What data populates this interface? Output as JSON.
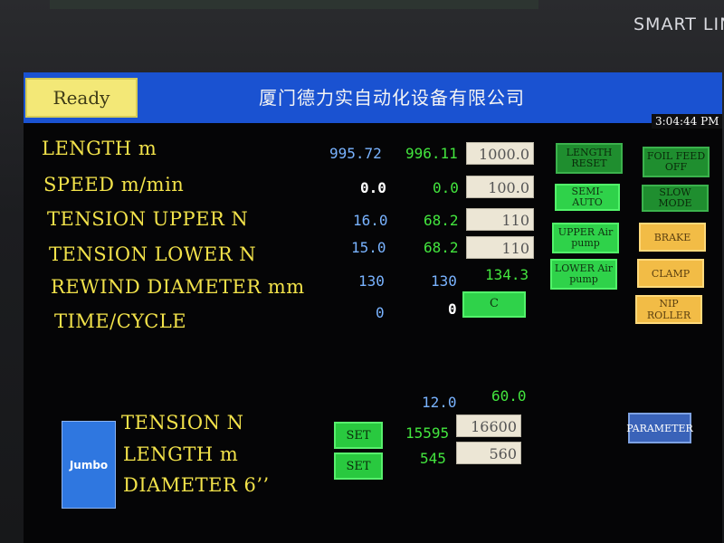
{
  "bezel": {
    "brand": "SMART LIN"
  },
  "header": {
    "status": "Ready",
    "company": "厦门德力实自动化设备有限公司",
    "clock": "3:04:44 PM"
  },
  "rows": [
    {
      "label": "LENGTH m",
      "actual": "995.72",
      "actual2": "996.11",
      "set": "1000.0"
    },
    {
      "label": "SPEED m/min",
      "actual": "0.0",
      "actual2": "0.0",
      "set": "100.0"
    },
    {
      "label": "TENSION UPPER N",
      "actual": "16.0",
      "actual2": "68.2",
      "set": "110"
    },
    {
      "label": "TENSION LOWER N",
      "actual": "15.0",
      "actual2": "68.2",
      "set": "110"
    },
    {
      "label": "REWIND DIAMETER mm",
      "actual": "130",
      "actual2": "130",
      "set": "134.3"
    },
    {
      "label": "TIME/CYCLE",
      "actual": "0",
      "actual2": "0",
      "set": "C"
    }
  ],
  "buttons": {
    "length_reset": "LENGTH RESET",
    "foil_feed_off": "FOIL FEED OFF",
    "semi_auto": "SEMI-AUTO",
    "slow_mode": "SLOW MODE",
    "upper_air_pump": "UPPER Air pump",
    "brake": "BRAKE",
    "lower_air_pump": "LOWER Air pump",
    "clamp": "CLAMP",
    "nip_roller": "NIP ROLLER",
    "parameter": "PARAMETER"
  },
  "jumbo": {
    "button": "Jumbo",
    "top_values": {
      "a": "12.0",
      "b": "60.0"
    },
    "items": [
      {
        "label": "TENSION N"
      },
      {
        "label": "LENGTH m",
        "set_button": "SET",
        "value": "15595",
        "input": "16600"
      },
      {
        "label": "DIAMETER 6’’",
        "set_button": "SET",
        "value": "545",
        "input": "560"
      }
    ]
  }
}
